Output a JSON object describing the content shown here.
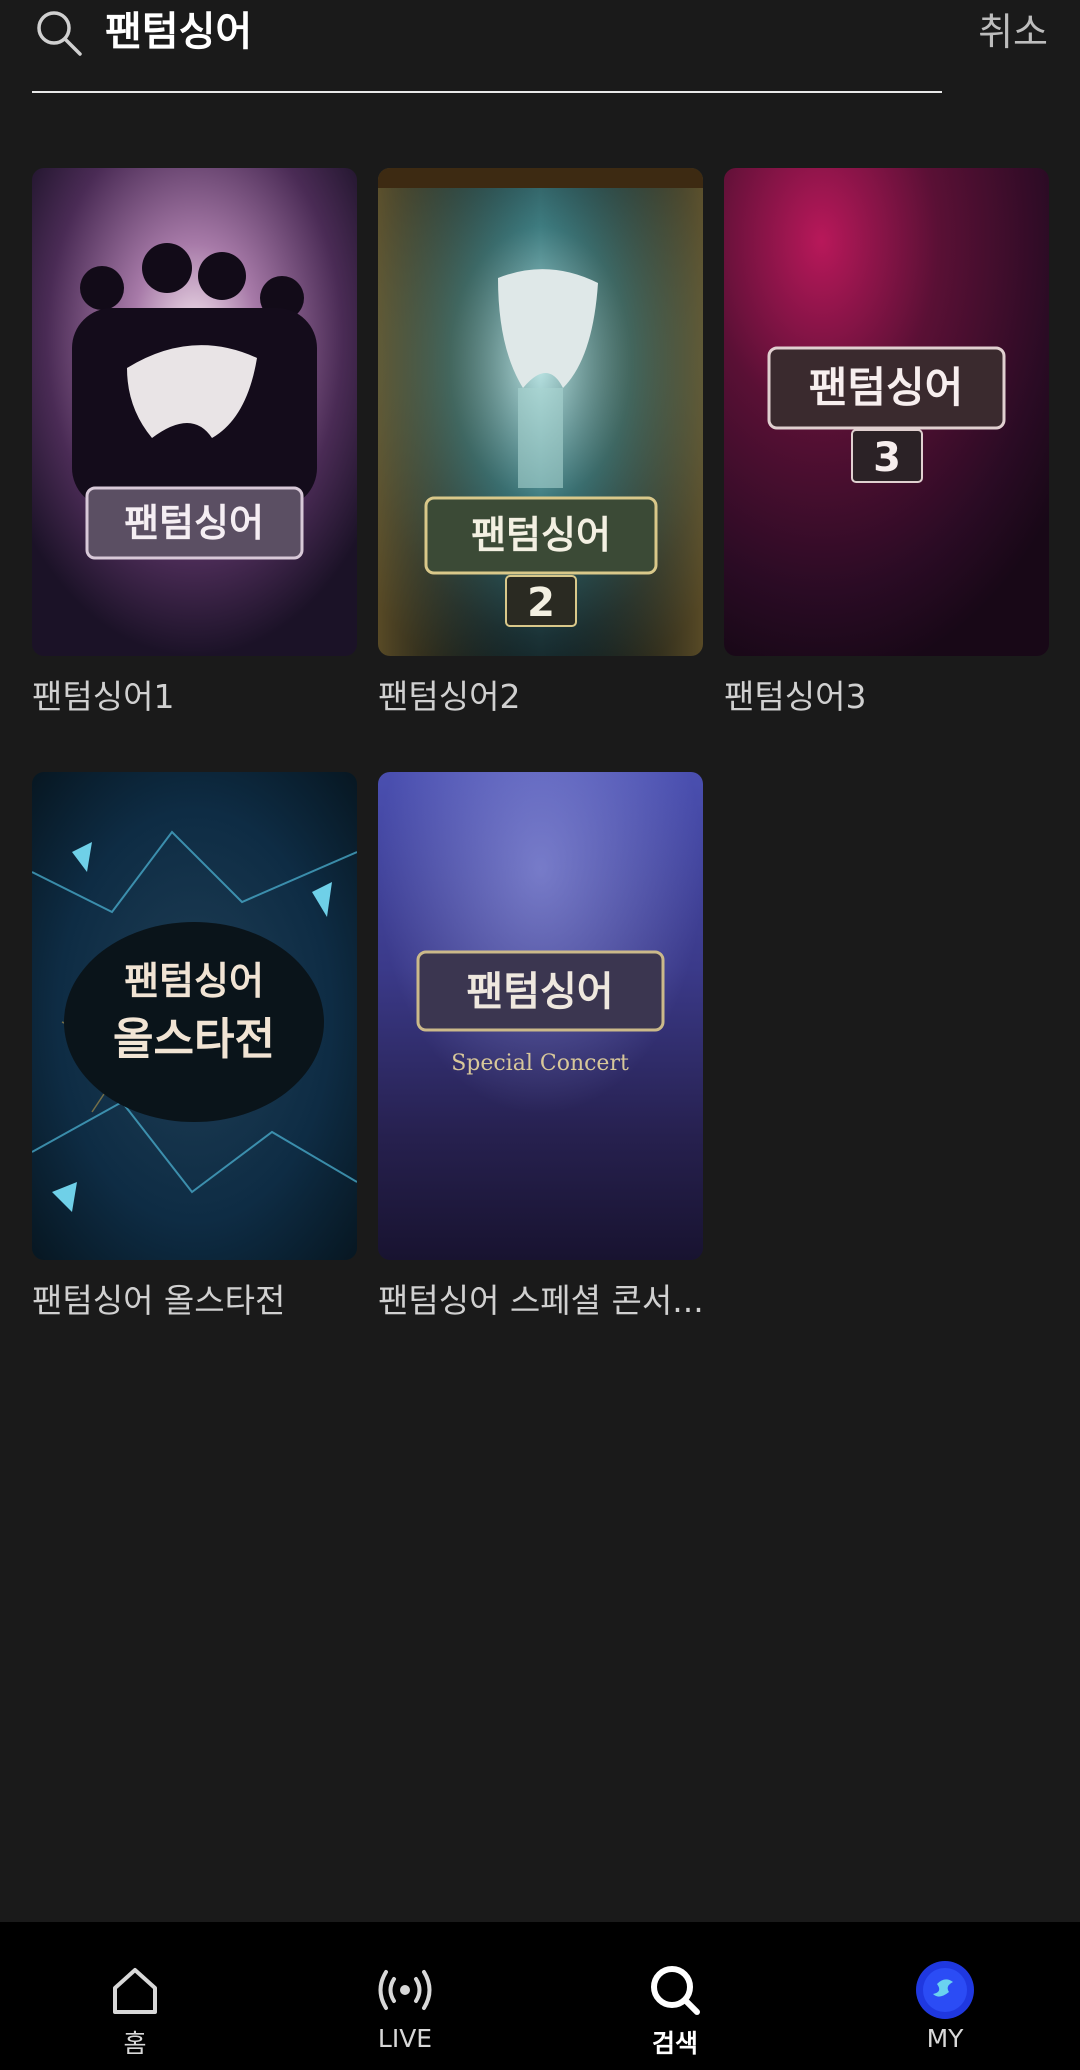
{
  "search": {
    "query": "팬텀싱어",
    "cancel_label": "취소"
  },
  "results": [
    {
      "title": "팬텀싱어1",
      "poster_text": "팬텀싱어"
    },
    {
      "title": "팬텀싱어2",
      "poster_text": "팬텀싱어",
      "poster_subtext": "2"
    },
    {
      "title": "팬텀싱어3",
      "poster_text": "팬텀싱어",
      "poster_subtext": "3"
    },
    {
      "title": "팬텀싱어 올스타전",
      "poster_text": "팬텀싱어",
      "poster_subtext": "올스타전"
    },
    {
      "title": "팬텀싱어 스페셜 콘서...",
      "poster_text": "팬텀싱어",
      "poster_subtext": "Special Concert"
    }
  ],
  "nav": {
    "items": [
      {
        "label": "홈",
        "icon": "home-icon"
      },
      {
        "label": "LIVE",
        "icon": "live-icon"
      },
      {
        "label": "검색",
        "icon": "search-icon",
        "active": true
      },
      {
        "label": "MY",
        "icon": "avatar"
      }
    ]
  },
  "colors": {
    "background": "#1a1a1a",
    "nav_background": "#000000",
    "divider": "#e8e8e8",
    "secondary_text": "#d0d0d0"
  }
}
